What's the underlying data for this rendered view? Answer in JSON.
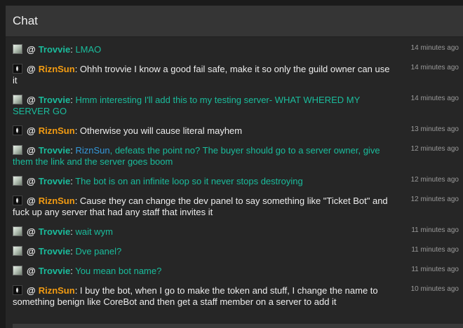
{
  "header": {
    "title": "Chat"
  },
  "messages": [
    {
      "user": "Trovvie",
      "text": "LMAO",
      "time": "14 minutes ago"
    },
    {
      "user": "RiznSun",
      "text": "Ohhh trovvie I know a good fail safe, make it so only the guild owner can use it",
      "time": "14 minutes ago"
    },
    {
      "user": "Trovvie",
      "text": "Hmm interesting I'll add this to my testing server- WHAT WHERED MY SERVER GO",
      "time": "14 minutes ago"
    },
    {
      "user": "RiznSun",
      "text": "Otherwise you will cause literal mayhem",
      "time": "13 minutes ago"
    },
    {
      "user": "Trovvie",
      "mention": "RiznSun",
      "text": ", defeats the point no? The buyer should go to a server owner, give them the link and the server goes boom",
      "time": "12 minutes ago"
    },
    {
      "user": "Trovvie",
      "text": "The bot is on an infinite loop so it never stops destroying",
      "time": "12 minutes ago"
    },
    {
      "user": "RiznSun",
      "text": "Cause they can change the dev panel to say something like \"Ticket Bot\" and fuck up any server that had any staff that invites it",
      "time": "12 minutes ago"
    },
    {
      "user": "Trovvie",
      "text": "wait wym",
      "time": "11 minutes ago"
    },
    {
      "user": "Trovvie",
      "text": "Dve panel?",
      "time": "11 minutes ago"
    },
    {
      "user": "Trovvie",
      "text": "You mean bot name?",
      "time": "11 minutes ago"
    },
    {
      "user": "RiznSun",
      "text": "I buy the bot, when I go to make the token and stuff, I change the name to something benign like CoreBot and then get a staff member on a server to add it",
      "time": "10 minutes ago"
    }
  ],
  "colors": {
    "trovvie": "#1abc9c",
    "riznsun": "#f39c12",
    "mention": "#3498db"
  }
}
